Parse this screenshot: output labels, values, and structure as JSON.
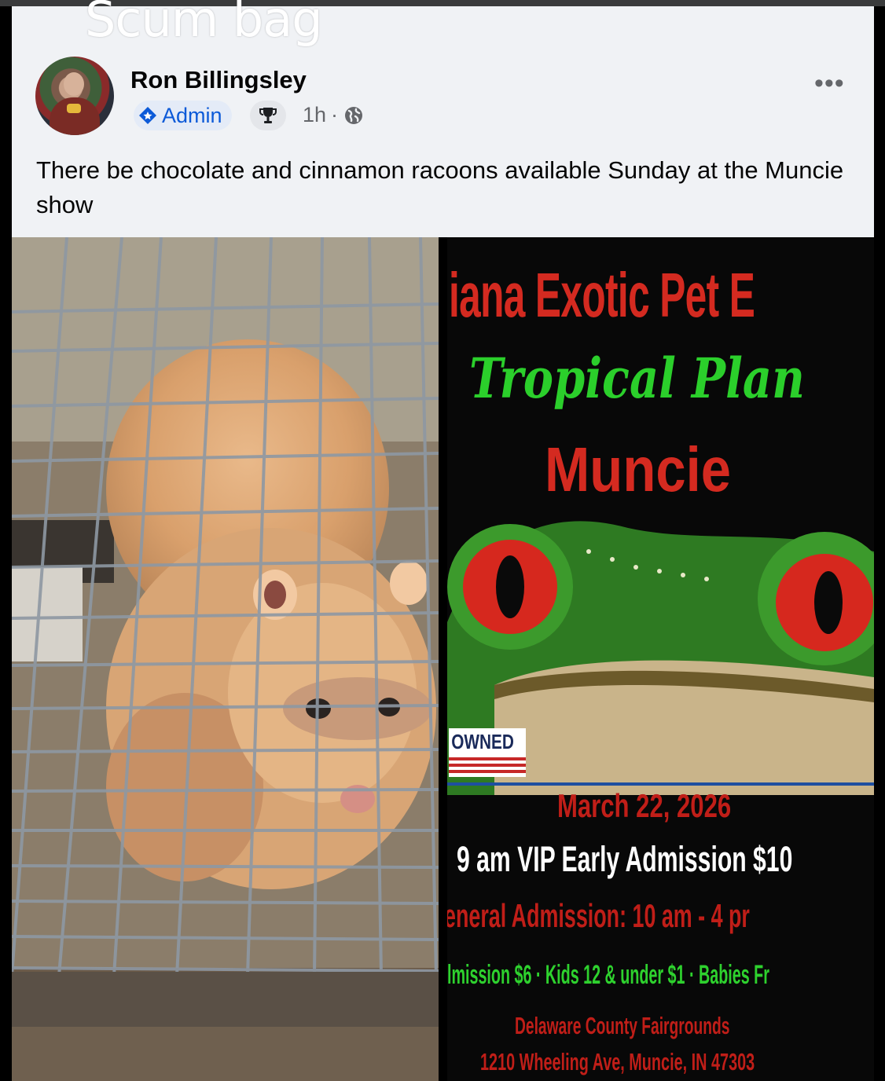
{
  "overlay": {
    "caption": "Scum bag"
  },
  "post": {
    "author": "Ron Billingsley",
    "badge_label": "Admin",
    "timestamp": "1h",
    "separator": "·",
    "more_label": "•••",
    "text": "There be chocolate and cinnamon racoons available Sunday at the Muncie show"
  },
  "icons": {
    "admin": "shield-icon",
    "trophy": "trophy-icon",
    "audience": "globe-icon",
    "more": "more-options-icon"
  },
  "flyer": {
    "title_line1": "iana Exotic Pet E",
    "title_line2": "Tropical Plan",
    "city": "Muncie",
    "owned_badge": "OWNED",
    "date": "March 22, 2026",
    "vip": "9 am VIP Early Admission $10",
    "general": "eneral Admission: 10 am - 4 pr",
    "prices": "lmission $6 · Kids 12 & under $1 · Babies Fr",
    "venue": "Delaware County Fairgrounds",
    "address": "1210 Wheeling Ave, Muncie, IN 47303"
  },
  "colors": {
    "admin_blue": "#0c5ad8",
    "flyer_red": "#d0201a",
    "flyer_green": "#22c322",
    "frog_green": "#3a9a2a"
  }
}
